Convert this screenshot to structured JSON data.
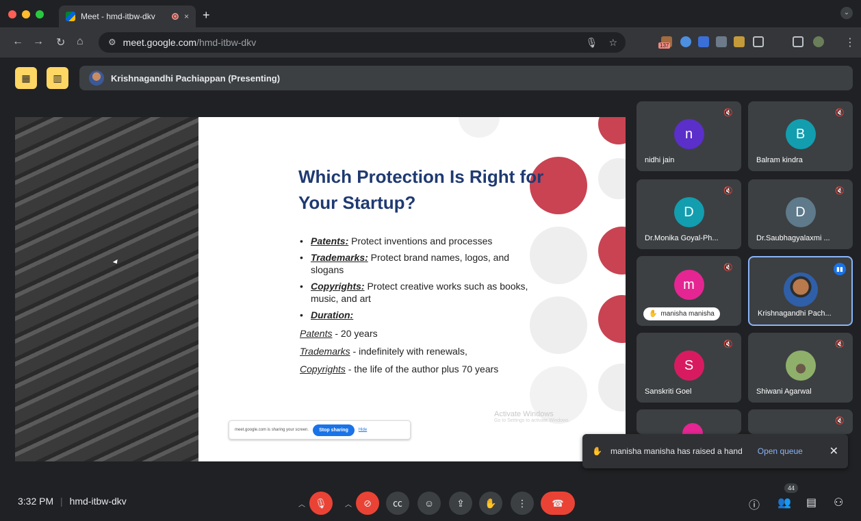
{
  "browser": {
    "tab_title": "Meet - hmd-itbw-dkv",
    "tab_close": "×",
    "new_tab": "+",
    "url_host": "meet.google.com",
    "url_path": "/hmd-itbw-dkv",
    "ext_badge": "137"
  },
  "meet": {
    "presenter_bar": "Krishnagandhi Pachiappan (Presenting)",
    "slide": {
      "title": "Which Protection Is Right for Your Startup?",
      "bullets": [
        {
          "term": "Patents:",
          "text": " Protect inventions and processes"
        },
        {
          "term": "Trademarks:",
          "text": " Protect brand names, logos, and slogans"
        },
        {
          "term": "Copyrights:",
          "text": " Protect creative works such as books, music, and art"
        },
        {
          "term": "Duration:",
          "text": ""
        }
      ],
      "durations": [
        {
          "term": "Patents",
          "text": " - 20 years"
        },
        {
          "term": "Trademarks",
          "text": " - indefinitely with renewals,"
        },
        {
          "term": "Copyrights",
          "text": " - the life of the author plus 70 years"
        }
      ],
      "share_notice": "meet.google.com is sharing your screen.",
      "stop_sharing": "Stop sharing",
      "hide": "Hide",
      "watermark_title": "Activate Windows",
      "watermark_sub": "Go to Settings to activate Windows."
    },
    "participants": [
      {
        "initial": "n",
        "name": "nidhi jain",
        "color": "#5b2fc9"
      },
      {
        "initial": "B",
        "name": "Balram kindra",
        "color": "#129eaf"
      },
      {
        "initial": "D",
        "name": "Dr.Monika Goyal-Ph...",
        "color": "#129eaf"
      },
      {
        "initial": "D",
        "name": "Dr.Saubhagyalaxmi ...",
        "color": "#5f7a8a"
      },
      {
        "initial": "m",
        "name": "manisha manisha",
        "color": "#e52592"
      },
      {
        "initial": "",
        "name": "Krishnagandhi Pach...",
        "color": "#3b5998"
      },
      {
        "initial": "S",
        "name": "Sanskriti Goel",
        "color": "#d81b60"
      },
      {
        "initial": "",
        "name": "Shiwani Agarwal",
        "color": "#6a8a5a"
      }
    ],
    "toast": {
      "text": "manisha manisha has raised a hand",
      "action": "Open queue"
    },
    "footer": {
      "time": "3:32 PM",
      "separator": "|",
      "meeting_code": "hmd-itbw-dkv",
      "people_count": "44"
    }
  }
}
